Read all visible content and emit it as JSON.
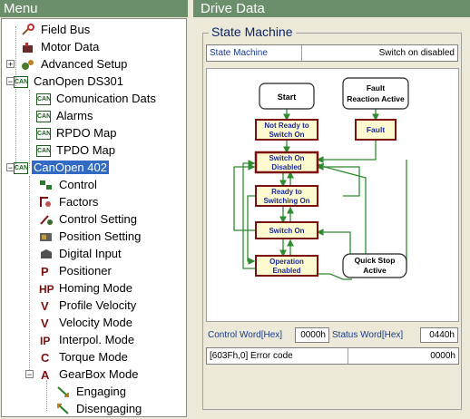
{
  "menu": {
    "title": "Menu",
    "items": [
      {
        "label": "Field Bus",
        "icon": "wrench-icon"
      },
      {
        "label": "Motor Data",
        "icon": "motor-icon"
      },
      {
        "label": "Advanced Setup",
        "icon": "gears-icon"
      },
      {
        "label": "CanOpen DS301",
        "icon": "canopen-icon"
      },
      {
        "label": "Comunication Dats",
        "icon": "canopen-icon"
      },
      {
        "label": "Alarms",
        "icon": "canopen-icon"
      },
      {
        "label": "RPDO Map",
        "icon": "canopen-icon"
      },
      {
        "label": "TPDO Map",
        "icon": "canopen-icon"
      },
      {
        "label": "CanOpen 402",
        "icon": "canopen-icon"
      },
      {
        "label": "Control",
        "icon": "control-icon"
      },
      {
        "label": "Factors",
        "icon": "factors-icon"
      },
      {
        "label": "Control Setting",
        "icon": "control-setting-icon"
      },
      {
        "label": "Position Setting",
        "icon": "position-setting-icon"
      },
      {
        "label": "Digital Input",
        "icon": "digital-input-icon"
      },
      {
        "label": "Positioner",
        "icon": "positioner-icon"
      },
      {
        "label": "Homing Mode",
        "icon": "homing-icon"
      },
      {
        "label": "Profile Velocity",
        "icon": "profile-velocity-icon"
      },
      {
        "label": "Velocity Mode",
        "icon": "velocity-mode-icon"
      },
      {
        "label": "Interpol. Mode",
        "icon": "interpol-icon"
      },
      {
        "label": "Torque Mode",
        "icon": "torque-icon"
      },
      {
        "label": "GearBox Mode",
        "icon": "gearbox-icon"
      },
      {
        "label": "Engaging",
        "icon": "engaging-icon"
      },
      {
        "label": "Disengaging",
        "icon": "disengaging-icon"
      }
    ]
  },
  "drive": {
    "title": "Drive Data",
    "group_title": "State Machine",
    "state_label": "State Machine",
    "state_value": "Switch on disabled",
    "diagram": {
      "start": "Start",
      "fault_reaction_1": "Fault",
      "fault_reaction_2": "Reaction Active",
      "not_ready_1": "Not Ready to",
      "not_ready_2": "Switch On",
      "fault": "Fault",
      "switch_on_disabled_1": "Switch On",
      "switch_on_disabled_2": "Disabled",
      "ready_1": "Ready to",
      "ready_2": "Switching On",
      "switch_on": "Switch On",
      "operation_1": "Operation",
      "operation_2": "Enabled",
      "quick_stop_1": "Quick Stop",
      "quick_stop_2": "Active"
    },
    "control_word_label": "Control Word[Hex]",
    "control_word_value": "0000h",
    "status_word_label": "Status Word[Hex]",
    "status_word_value": "0440h",
    "error_label": "[603Fh,0] Error code",
    "error_value": "0000h"
  },
  "colors": {
    "accent_green": "#6b8e6b",
    "state_dark_red": "#7a1010",
    "state_text_blue": "#1a2a9a",
    "arrow_green": "#2e8b2e",
    "state_fill_yellow": "#fffbd0"
  }
}
